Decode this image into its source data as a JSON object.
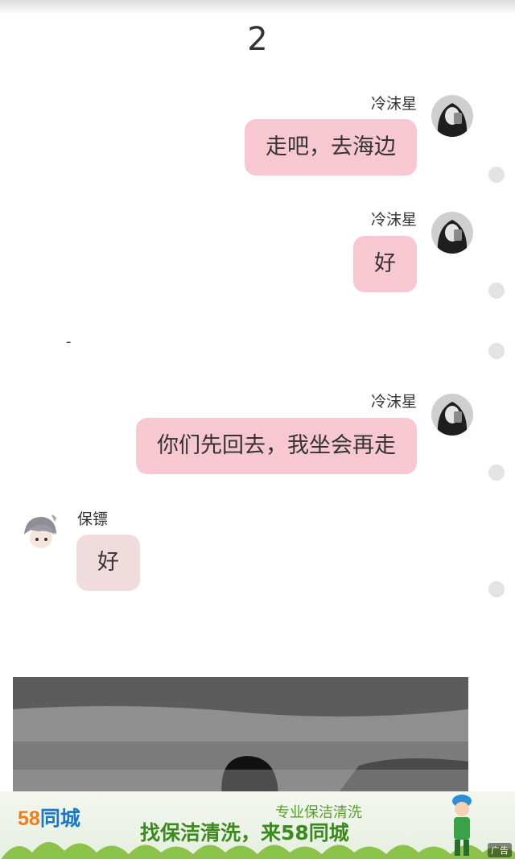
{
  "chapter_number": "2",
  "messages": [
    {
      "sender": "冷沫星",
      "text": "走吧，去海边",
      "side": "right"
    },
    {
      "sender": "冷沫星",
      "text": "好",
      "side": "right"
    },
    {
      "sender": "冷沫星",
      "text": "你们先回去，我坐会再走",
      "side": "right"
    },
    {
      "sender": "保镖",
      "text": "好",
      "side": "left"
    }
  ],
  "separator_text": "-",
  "ad": {
    "logo_number": "58",
    "logo_text": "同城",
    "subtitle": "专业保洁清洗",
    "headline": "找保洁清洗，来58同城",
    "mark": "广告"
  },
  "colors": {
    "bubble_right": "#f8c8d2",
    "bubble_left": "#f0dcdc",
    "ad_green": "#3c8a1e",
    "logo_orange": "#f07d19",
    "logo_blue": "#1a78c8"
  },
  "icons": [
    "girl-avatar",
    "boy-avatar",
    "leaf-icon"
  ]
}
